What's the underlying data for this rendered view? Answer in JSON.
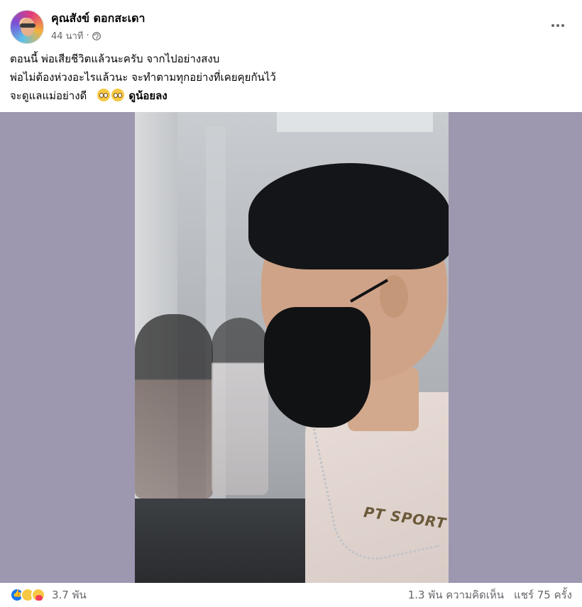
{
  "post": {
    "author": "คุณสังข์ ดอกสะเดา",
    "time": "44 นาที",
    "separator": "·",
    "lines": [
      "ตอนนี้ พ่อเสียชีวิตแล้วนะครับ จากไปอย่างสงบ",
      "พ่อไม่ต้องห่วงอะไรแล้วนะ จะทำตามทุกอย่างที่เคยคุยกันไว้",
      "จะดูแลแม่อย่างดี"
    ],
    "see_less": "ดูน้อยลง",
    "photo_brand": "PT SPORT"
  },
  "stats": {
    "reaction_count": "3.7 พัน",
    "comments": "1.3 พัน ความคิดเห็น",
    "shares": "แชร์ 75 ครั้ง"
  },
  "icons": {
    "privacy": "globe-icon",
    "more": "more-options-icon",
    "reactions": [
      "like-reaction-icon",
      "sad-reaction-icon",
      "care-reaction-icon"
    ]
  },
  "colors": {
    "media_background": "#9e97b0",
    "like_blue": "#1877f2",
    "meta_gray": "#65676b"
  }
}
